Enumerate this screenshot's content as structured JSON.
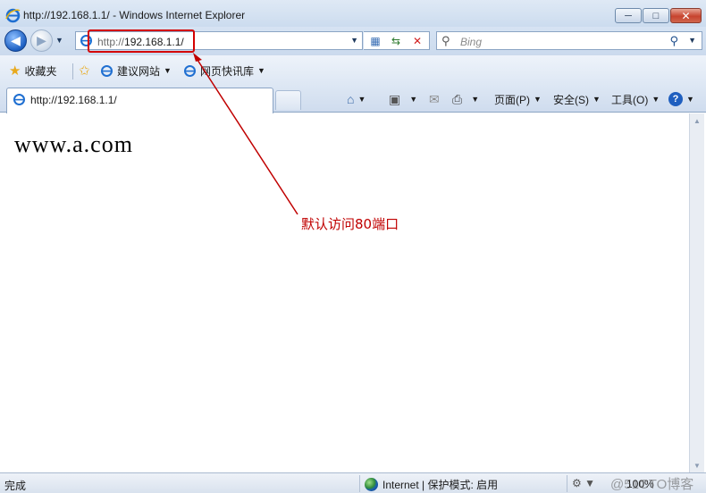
{
  "window": {
    "title": "http://192.168.1.1/ - Windows Internet Explorer",
    "minimize_label": "─",
    "maximize_label": "□",
    "close_label": "✕"
  },
  "address_bar": {
    "url_scheme": "http://",
    "url_host": "192.168.1.1/"
  },
  "search": {
    "placeholder": "Bing"
  },
  "favorites_bar": {
    "favorites_label": "收藏夹",
    "items": [
      "建议网站",
      "网页快讯库"
    ]
  },
  "tab": {
    "label": "http://192.168.1.1/"
  },
  "command_bar": {
    "page_label": "页面(P)",
    "safety_label": "安全(S)",
    "tools_label": "工具(O)"
  },
  "content": {
    "page_text": "www.a.com"
  },
  "annotation": {
    "text": "默认访问80端口",
    "color": "#c00000"
  },
  "status_bar": {
    "status": "完成",
    "zone": "Internet | 保护模式: 启用",
    "zoom": "100%",
    "watermark": "@51CTO博客"
  }
}
